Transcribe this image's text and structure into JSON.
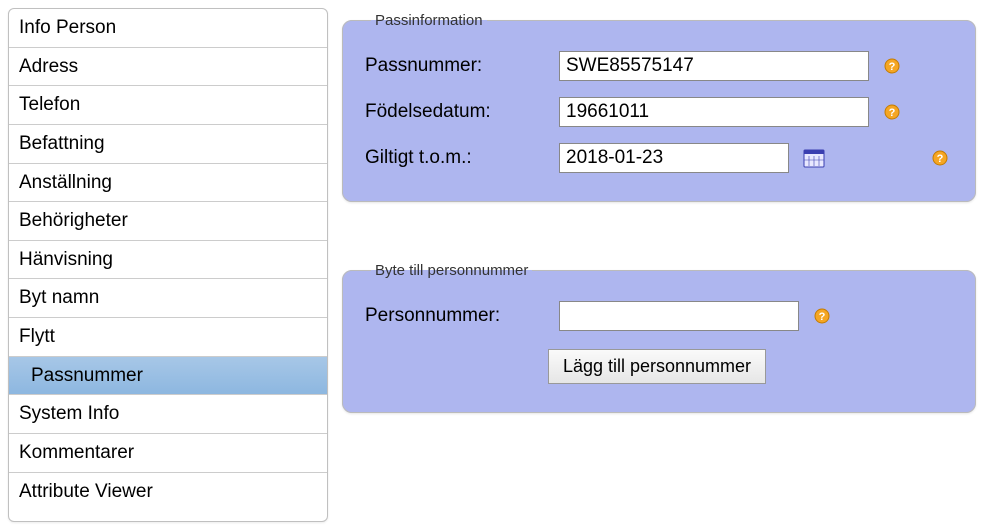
{
  "sidebar": {
    "items": [
      {
        "label": "Info Person",
        "selected": false
      },
      {
        "label": "Adress",
        "selected": false
      },
      {
        "label": "Telefon",
        "selected": false
      },
      {
        "label": "Befattning",
        "selected": false
      },
      {
        "label": "Anställning",
        "selected": false
      },
      {
        "label": "Behörigheter",
        "selected": false
      },
      {
        "label": "Hänvisning",
        "selected": false
      },
      {
        "label": "Byt namn",
        "selected": false
      },
      {
        "label": "Flytt",
        "selected": false
      },
      {
        "label": "Passnummer",
        "selected": true
      },
      {
        "label": "System Info",
        "selected": false
      },
      {
        "label": "Kommentarer",
        "selected": false
      },
      {
        "label": "Attribute Viewer",
        "selected": false
      }
    ]
  },
  "passinfo": {
    "legend": "Passinformation",
    "passnummer_label": "Passnummer:",
    "passnummer_value": "SWE85575147",
    "fodelsedatum_label": "Födelsedatum:",
    "fodelsedatum_value": "19661011",
    "giltigt_label": "Giltigt t.o.m.:",
    "giltigt_value": "2018-01-23"
  },
  "byte": {
    "legend": "Byte till personnummer",
    "personnummer_label": "Personnummer:",
    "personnummer_value": "",
    "add_button": "Lägg till personnummer"
  }
}
